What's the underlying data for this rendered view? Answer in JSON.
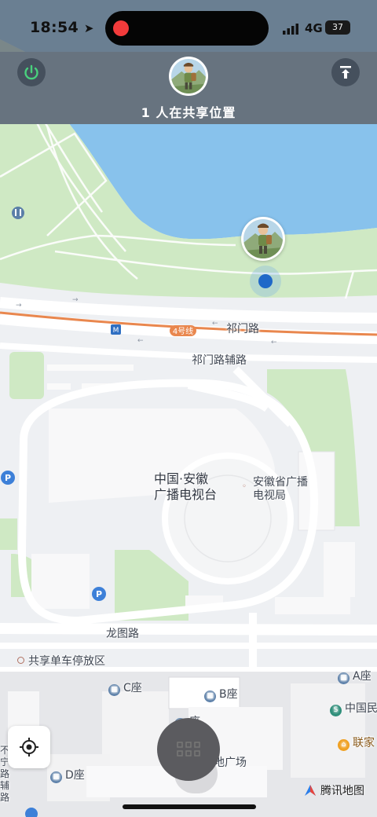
{
  "status_bar": {
    "time": "18:54",
    "network": "4G",
    "battery": "37"
  },
  "header": {
    "sharing_text": "1 人在共享位置"
  },
  "map": {
    "roads": {
      "qimen_road": "祁门路",
      "qimen_aux_road": "祁门路辅路",
      "longtu_road": "龙图路",
      "metro_line": "4号线"
    },
    "pois": {
      "tv_station_line1": "中国·安徽",
      "tv_station_line2": "广播电视台",
      "bureau_line1": "安徽省广播",
      "bureau_line2": "电视局",
      "bike_parking": "共享单车停放区",
      "c_block": "C座",
      "b_block": "B座",
      "a_block": "A座",
      "d_block": "D座",
      "plaza": "地广场",
      "zuo_partial": "座",
      "china_partial": "中国民",
      "lianjia_partial": "联家",
      "left_edge_text": "不\n宁\n路\n辅\n路"
    },
    "parking_marker": "P",
    "metro_marker": "M"
  },
  "branding": {
    "logo_text": "腾讯地图"
  },
  "icons": {
    "power": "power-icon",
    "upload": "share-upload-icon",
    "locate": "locate-crosshair-icon",
    "menu": "grid-dots-icon"
  },
  "colors": {
    "water": "#88c2ec",
    "park": "#cfe9c4",
    "road": "#ffffff",
    "metro": "#e9874e",
    "header": "#616c79"
  }
}
